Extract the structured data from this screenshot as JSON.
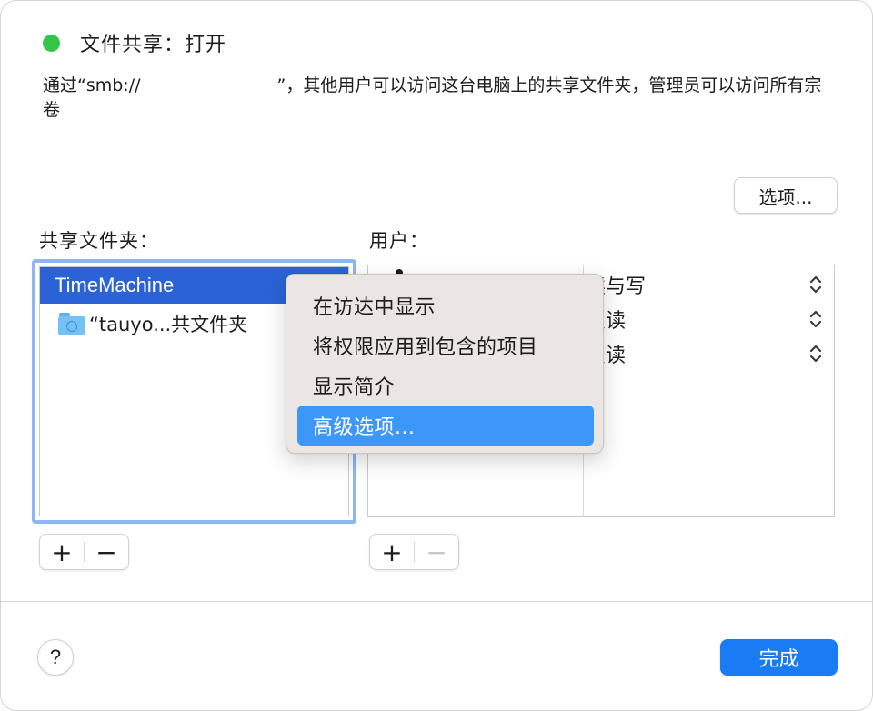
{
  "status": {
    "indicator_color": "#33c748",
    "title": "文件共享：打开"
  },
  "description": {
    "part1": "通过“smb://",
    "part2": "”，其他用户可以访问这台电脑上的共享文件夹，管理员可以访问所有宗卷"
  },
  "options_button": "选项...",
  "shared_folders": {
    "label": "共享文件夹：",
    "items": [
      {
        "name": "TimeMachine",
        "selected": true
      },
      {
        "name": "“tauyo...共文件夹",
        "selected": false
      }
    ]
  },
  "users": {
    "label": "用户：",
    "permissions": [
      {
        "value": "读与写"
      },
      {
        "value": "只读"
      },
      {
        "value": "只读"
      }
    ]
  },
  "folder_controls": {
    "add": "+",
    "remove": "−"
  },
  "user_controls": {
    "add": "+",
    "remove": "−"
  },
  "help_button": "?",
  "done_button": "完成",
  "context_menu": {
    "items": [
      {
        "label": "在访达中显示",
        "highlighted": false
      },
      {
        "label": "将权限应用到包含的项目",
        "highlighted": false
      },
      {
        "label": "显示简介",
        "highlighted": false
      },
      {
        "label": "高级选项...",
        "highlighted": true
      }
    ]
  },
  "colors": {
    "accent": "#1a7cf5",
    "selection": "#2b63d6",
    "menu_highlight": "#3d97f8"
  }
}
